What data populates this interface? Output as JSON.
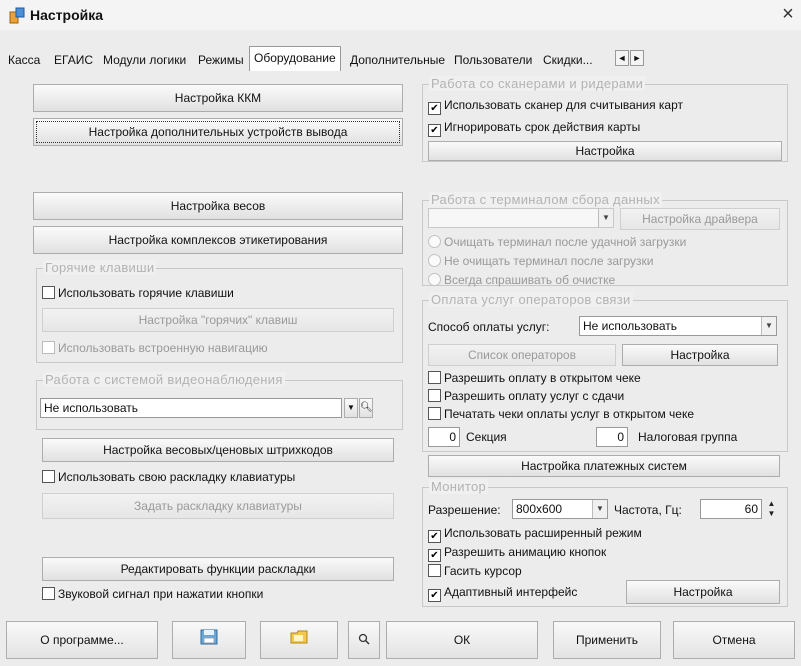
{
  "window": {
    "title": "Настройка",
    "close_label": "×"
  },
  "tabs": [
    {
      "label": "Касса"
    },
    {
      "label": "ЕГАИС"
    },
    {
      "label": "Модули логики"
    },
    {
      "label": "Режимы"
    },
    {
      "label": "Оборудование"
    },
    {
      "label": "Дополнительные"
    },
    {
      "label": "Пользователи"
    },
    {
      "label": "Скидки..."
    }
  ],
  "tab_scroll": {
    "left": "◄",
    "right": "►"
  },
  "left": {
    "kkm_button": "Настройка ККМ",
    "output_devices_button": "Настройка дополнительных устройств вывода",
    "scales_button": "Настройка весов",
    "labeling_button": "Настройка комплексов этикетирования",
    "hotkeys_group": {
      "title": "Горячие клавиши",
      "use_hotkeys": "Использовать горячие клавиши",
      "hotkeys_setup": "Настройка \"горячих\" клавиш",
      "builtin_nav": "Использовать встроенную навигацию"
    },
    "video_group": {
      "title": "Работа с системой видеонаблюдения",
      "combo_value": "Не использовать"
    },
    "barcode_button": "Настройка весовых/ценовых штрихкодов",
    "own_layout": "Использовать свою раскладку клавиатуры",
    "set_layout_button": "Задать раскладку клавиатуры",
    "edit_layout_button": "Редактировать функции раскладки",
    "beep": "Звуковой сигнал при нажатии кнопки"
  },
  "right": {
    "scanners_group": {
      "title": "Работа со сканерами и ридерами",
      "use_scanner": "Использовать сканер для считывания карт",
      "ignore_expiry": "Игнорировать срок действия карты",
      "setup_button": "Настройка"
    },
    "terminal_group": {
      "title": "Работа с терминалом сбора данных",
      "driver_button": "Настройка драйвера",
      "radio1": "Очищать терминал после удачной загрузки",
      "radio2": "Не очищать терминал после загрузки",
      "radio3": "Всегда спрашивать об очистке"
    },
    "operator_group": {
      "title": "Оплата услуг операторов связи",
      "payment_method_label": "Способ оплаты услуг:",
      "payment_method_value": "Не использовать",
      "operators_button": "Список операторов",
      "setup_button": "Настройка",
      "allow_open_check": "Разрешить оплату в открытом чеке",
      "allow_change": "Разрешить оплату услуг с сдачи",
      "print_checks": "Печатать чеки оплаты услуг в открытом чеке",
      "section_value": "0",
      "section_label": "Секция",
      "tax_value": "0",
      "tax_label": "Налоговая группа"
    },
    "payment_systems_button": "Настройка платежных систем",
    "monitor_group": {
      "title": "Монитор",
      "resolution_label": "Разрешение:",
      "resolution_value": "800x600",
      "freq_label": "Частота, Гц:",
      "freq_value": "60",
      "extended_mode": "Использовать расширенный режим",
      "button_animation": "Разрешить анимацию кнопок",
      "hide_cursor": "Гасить курсор",
      "adaptive": "Адаптивный интерфейс",
      "setup_button": "Настройка"
    }
  },
  "footer": {
    "about": "О программе...",
    "ok": "ОК",
    "apply": "Применить",
    "cancel": "Отмена"
  }
}
